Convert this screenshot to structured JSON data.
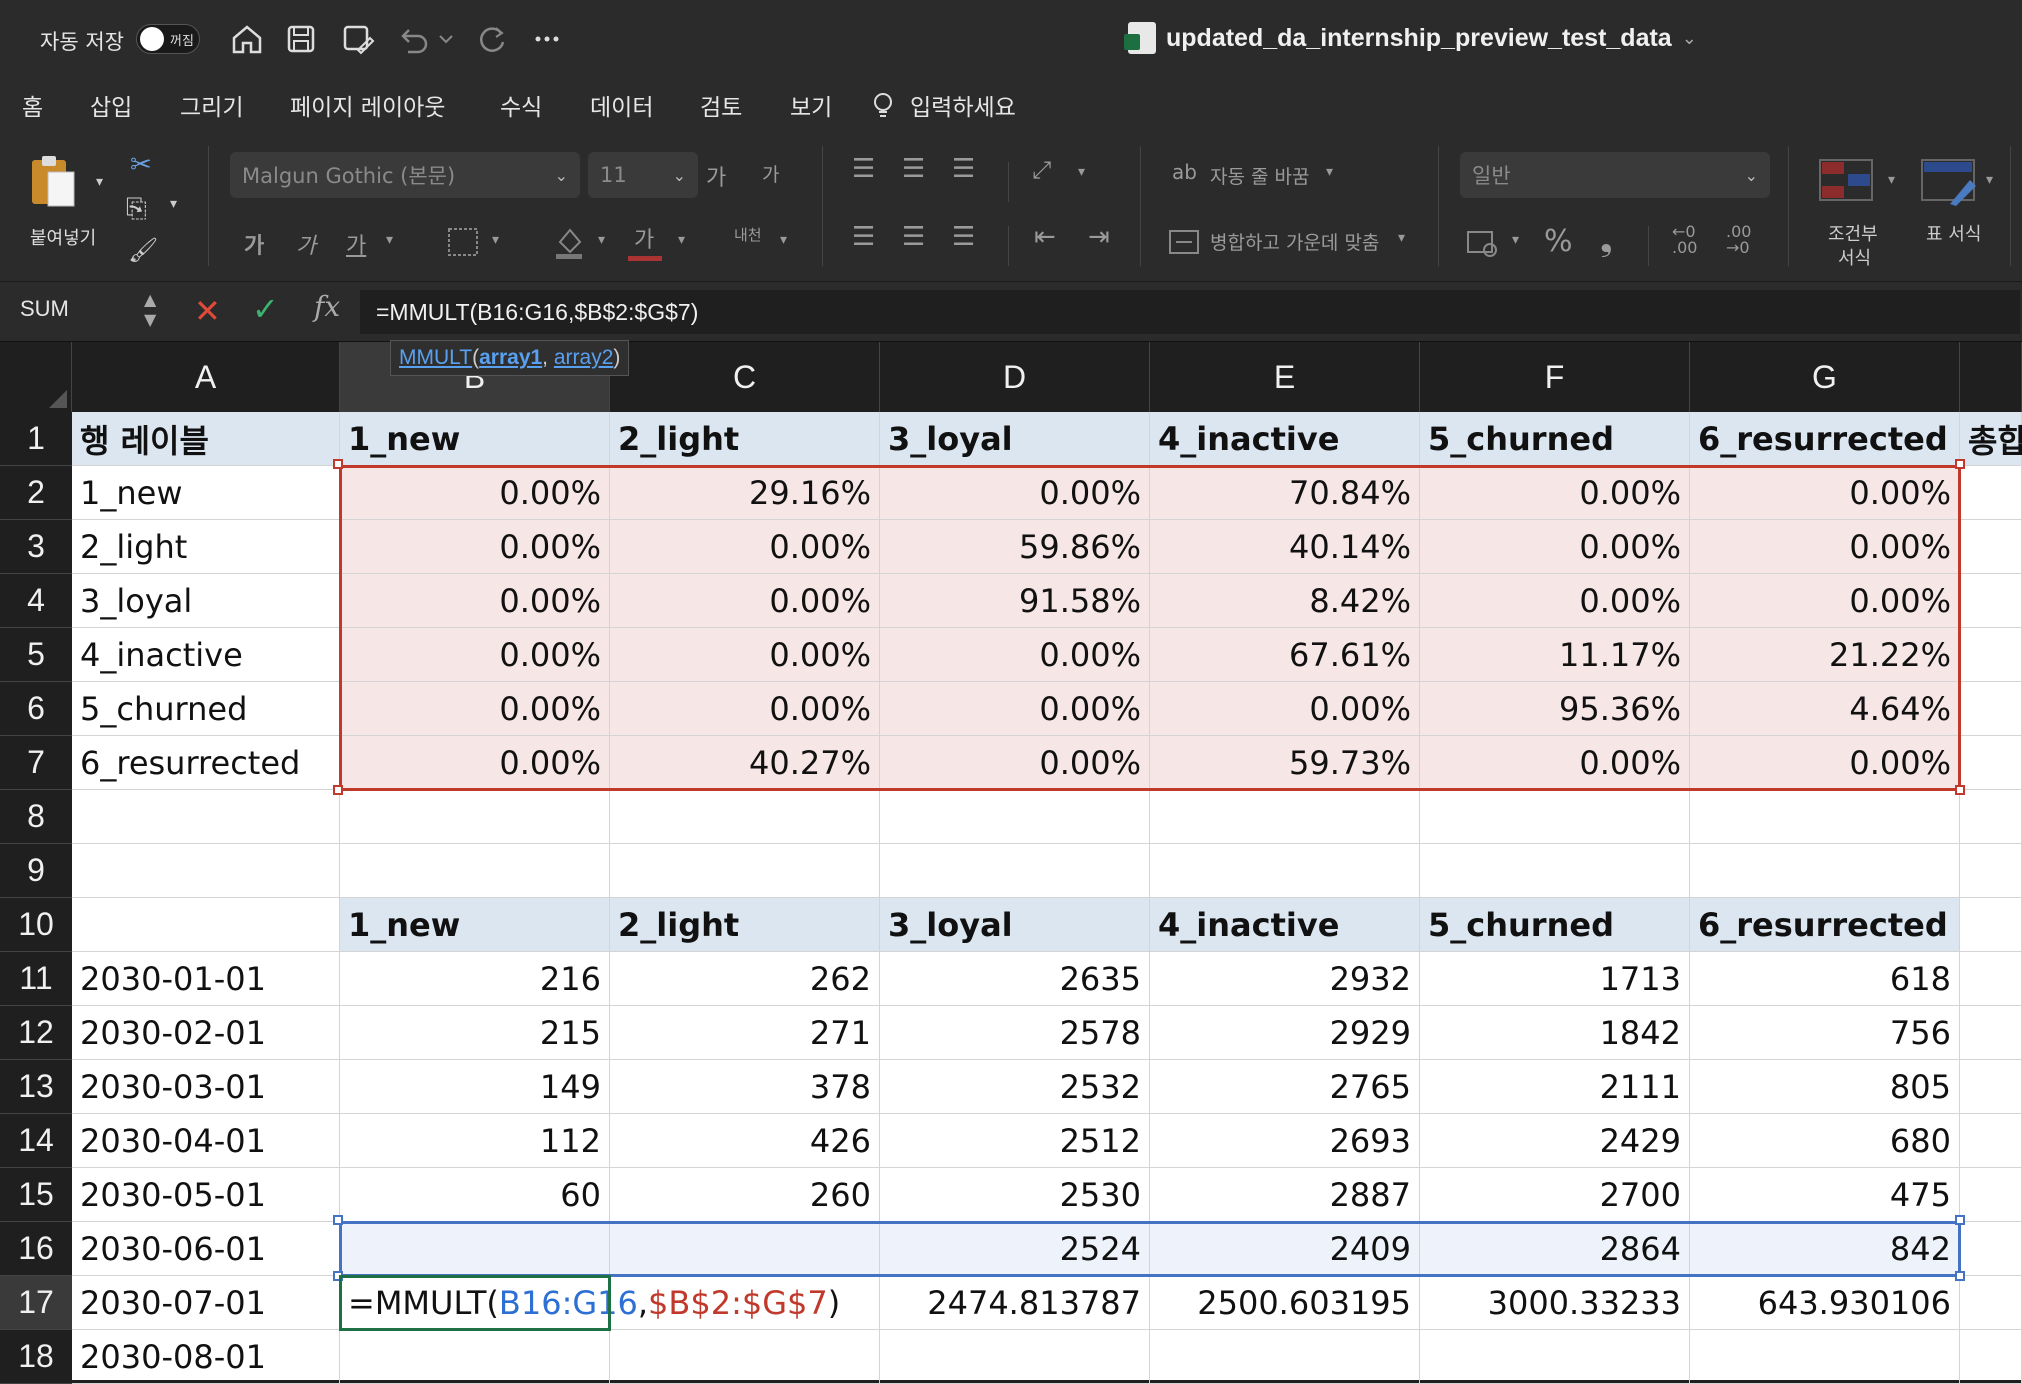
{
  "titlebar": {
    "autosave_label": "자동 저장",
    "toggle_state": "꺼짐",
    "document_title": "updated_da_internship_preview_test_data"
  },
  "tabs": [
    "홈",
    "삽입",
    "그리기",
    "페이지 레이아웃",
    "수식",
    "데이터",
    "검토",
    "보기",
    "입력하세요"
  ],
  "ribbon": {
    "paste_label": "붙여넣기",
    "font_name": "Malgun Gothic (본문)",
    "font_size": "11",
    "wrap_text": "자동 줄 바꿈",
    "merge_center": "병합하고 가운데 맞춤",
    "number_format": "일반",
    "conditional_format_line1": "조건부",
    "conditional_format_line2": "서식",
    "table_format": "표 서식",
    "font_buttons": [
      "가",
      "가",
      "가"
    ],
    "grow_font": "가",
    "shrink_font": "가",
    "font_color": "가",
    "vertical_text": "내천"
  },
  "formula_bar": {
    "name_box": "SUM",
    "fx": "fx",
    "formula": "=MMULT(B16:G16,$B$2:$G$7)"
  },
  "tooltip": {
    "fn": "MMULT",
    "open": "(",
    "arg1": "array1",
    "comma": ", ",
    "arg2": "array2",
    "close": ")"
  },
  "columns": [
    "A",
    "B",
    "C",
    "D",
    "E",
    "F",
    "G"
  ],
  "rows": [
    "1",
    "2",
    "3",
    "4",
    "5",
    "6",
    "7",
    "8",
    "9",
    "10",
    "11",
    "12",
    "13",
    "14",
    "15",
    "16",
    "17",
    "18"
  ],
  "sheet": {
    "r1": {
      "A": "행 레이블",
      "B": "1_new",
      "C": "2_light",
      "D": "3_loyal",
      "E": "4_inactive",
      "F": "5_churned",
      "G": "6_resurrected",
      "H": "총합"
    },
    "matrix_labels": [
      "1_new",
      "2_light",
      "3_loyal",
      "4_inactive",
      "5_churned",
      "6_resurrected"
    ],
    "matrix": [
      [
        "0.00%",
        "29.16%",
        "0.00%",
        "70.84%",
        "0.00%",
        "0.00%"
      ],
      [
        "0.00%",
        "0.00%",
        "59.86%",
        "40.14%",
        "0.00%",
        "0.00%"
      ],
      [
        "0.00%",
        "0.00%",
        "91.58%",
        "8.42%",
        "0.00%",
        "0.00%"
      ],
      [
        "0.00%",
        "0.00%",
        "0.00%",
        "67.61%",
        "11.17%",
        "21.22%"
      ],
      [
        "0.00%",
        "0.00%",
        "0.00%",
        "0.00%",
        "95.36%",
        "4.64%"
      ],
      [
        "0.00%",
        "40.27%",
        "0.00%",
        "59.73%",
        "0.00%",
        "0.00%"
      ]
    ],
    "r10": [
      "1_new",
      "2_light",
      "3_loyal",
      "4_inactive",
      "5_churned",
      "6_resurrected"
    ],
    "dates": [
      "2030-01-01",
      "2030-02-01",
      "2030-03-01",
      "2030-04-01",
      "2030-05-01",
      "2030-06-01",
      "2030-07-01",
      "2030-08-01"
    ],
    "counts": [
      [
        "216",
        "262",
        "2635",
        "2932",
        "1713",
        "618"
      ],
      [
        "215",
        "271",
        "2578",
        "2929",
        "1842",
        "756"
      ],
      [
        "149",
        "378",
        "2532",
        "2765",
        "2111",
        "805"
      ],
      [
        "112",
        "426",
        "2512",
        "2693",
        "2429",
        "680"
      ],
      [
        "60",
        "260",
        "2530",
        "2887",
        "2700",
        "475"
      ],
      [
        "",
        "",
        "2524",
        "2409",
        "2864",
        "842"
      ]
    ],
    "r17_formula_prefix": "=MMULT(",
    "r17_ref1": "B16:G16",
    "r17_comma": ",",
    "r17_ref2": "$B$2:$G$7",
    "r17_close": ")",
    "r17_values": [
      "2474.813787",
      "2500.603195",
      "3000.33233",
      "643.930106"
    ]
  }
}
